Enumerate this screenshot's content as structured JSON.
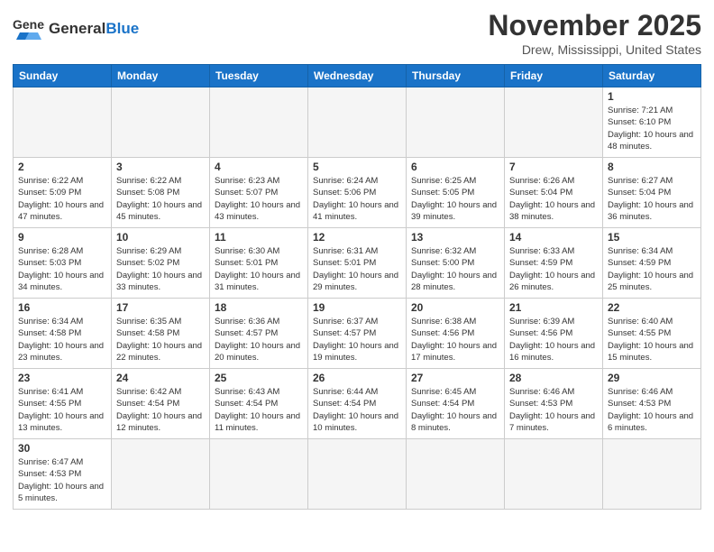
{
  "header": {
    "logo_general": "General",
    "logo_blue": "Blue",
    "title": "November 2025",
    "subtitle": "Drew, Mississippi, United States"
  },
  "weekdays": [
    "Sunday",
    "Monday",
    "Tuesday",
    "Wednesday",
    "Thursday",
    "Friday",
    "Saturday"
  ],
  "weeks": [
    [
      {
        "day": "",
        "info": ""
      },
      {
        "day": "",
        "info": ""
      },
      {
        "day": "",
        "info": ""
      },
      {
        "day": "",
        "info": ""
      },
      {
        "day": "",
        "info": ""
      },
      {
        "day": "",
        "info": ""
      },
      {
        "day": "1",
        "info": "Sunrise: 7:21 AM\nSunset: 6:10 PM\nDaylight: 10 hours and 48 minutes."
      }
    ],
    [
      {
        "day": "2",
        "info": "Sunrise: 6:22 AM\nSunset: 5:09 PM\nDaylight: 10 hours and 47 minutes."
      },
      {
        "day": "3",
        "info": "Sunrise: 6:22 AM\nSunset: 5:08 PM\nDaylight: 10 hours and 45 minutes."
      },
      {
        "day": "4",
        "info": "Sunrise: 6:23 AM\nSunset: 5:07 PM\nDaylight: 10 hours and 43 minutes."
      },
      {
        "day": "5",
        "info": "Sunrise: 6:24 AM\nSunset: 5:06 PM\nDaylight: 10 hours and 41 minutes."
      },
      {
        "day": "6",
        "info": "Sunrise: 6:25 AM\nSunset: 5:05 PM\nDaylight: 10 hours and 39 minutes."
      },
      {
        "day": "7",
        "info": "Sunrise: 6:26 AM\nSunset: 5:04 PM\nDaylight: 10 hours and 38 minutes."
      },
      {
        "day": "8",
        "info": "Sunrise: 6:27 AM\nSunset: 5:04 PM\nDaylight: 10 hours and 36 minutes."
      }
    ],
    [
      {
        "day": "9",
        "info": "Sunrise: 6:28 AM\nSunset: 5:03 PM\nDaylight: 10 hours and 34 minutes."
      },
      {
        "day": "10",
        "info": "Sunrise: 6:29 AM\nSunset: 5:02 PM\nDaylight: 10 hours and 33 minutes."
      },
      {
        "day": "11",
        "info": "Sunrise: 6:30 AM\nSunset: 5:01 PM\nDaylight: 10 hours and 31 minutes."
      },
      {
        "day": "12",
        "info": "Sunrise: 6:31 AM\nSunset: 5:01 PM\nDaylight: 10 hours and 29 minutes."
      },
      {
        "day": "13",
        "info": "Sunrise: 6:32 AM\nSunset: 5:00 PM\nDaylight: 10 hours and 28 minutes."
      },
      {
        "day": "14",
        "info": "Sunrise: 6:33 AM\nSunset: 4:59 PM\nDaylight: 10 hours and 26 minutes."
      },
      {
        "day": "15",
        "info": "Sunrise: 6:34 AM\nSunset: 4:59 PM\nDaylight: 10 hours and 25 minutes."
      }
    ],
    [
      {
        "day": "16",
        "info": "Sunrise: 6:34 AM\nSunset: 4:58 PM\nDaylight: 10 hours and 23 minutes."
      },
      {
        "day": "17",
        "info": "Sunrise: 6:35 AM\nSunset: 4:58 PM\nDaylight: 10 hours and 22 minutes."
      },
      {
        "day": "18",
        "info": "Sunrise: 6:36 AM\nSunset: 4:57 PM\nDaylight: 10 hours and 20 minutes."
      },
      {
        "day": "19",
        "info": "Sunrise: 6:37 AM\nSunset: 4:57 PM\nDaylight: 10 hours and 19 minutes."
      },
      {
        "day": "20",
        "info": "Sunrise: 6:38 AM\nSunset: 4:56 PM\nDaylight: 10 hours and 17 minutes."
      },
      {
        "day": "21",
        "info": "Sunrise: 6:39 AM\nSunset: 4:56 PM\nDaylight: 10 hours and 16 minutes."
      },
      {
        "day": "22",
        "info": "Sunrise: 6:40 AM\nSunset: 4:55 PM\nDaylight: 10 hours and 15 minutes."
      }
    ],
    [
      {
        "day": "23",
        "info": "Sunrise: 6:41 AM\nSunset: 4:55 PM\nDaylight: 10 hours and 13 minutes."
      },
      {
        "day": "24",
        "info": "Sunrise: 6:42 AM\nSunset: 4:54 PM\nDaylight: 10 hours and 12 minutes."
      },
      {
        "day": "25",
        "info": "Sunrise: 6:43 AM\nSunset: 4:54 PM\nDaylight: 10 hours and 11 minutes."
      },
      {
        "day": "26",
        "info": "Sunrise: 6:44 AM\nSunset: 4:54 PM\nDaylight: 10 hours and 10 minutes."
      },
      {
        "day": "27",
        "info": "Sunrise: 6:45 AM\nSunset: 4:54 PM\nDaylight: 10 hours and 8 minutes."
      },
      {
        "day": "28",
        "info": "Sunrise: 6:46 AM\nSunset: 4:53 PM\nDaylight: 10 hours and 7 minutes."
      },
      {
        "day": "29",
        "info": "Sunrise: 6:46 AM\nSunset: 4:53 PM\nDaylight: 10 hours and 6 minutes."
      }
    ],
    [
      {
        "day": "30",
        "info": "Sunrise: 6:47 AM\nSunset: 4:53 PM\nDaylight: 10 hours and 5 minutes."
      },
      {
        "day": "",
        "info": ""
      },
      {
        "day": "",
        "info": ""
      },
      {
        "day": "",
        "info": ""
      },
      {
        "day": "",
        "info": ""
      },
      {
        "day": "",
        "info": ""
      },
      {
        "day": "",
        "info": ""
      }
    ]
  ]
}
